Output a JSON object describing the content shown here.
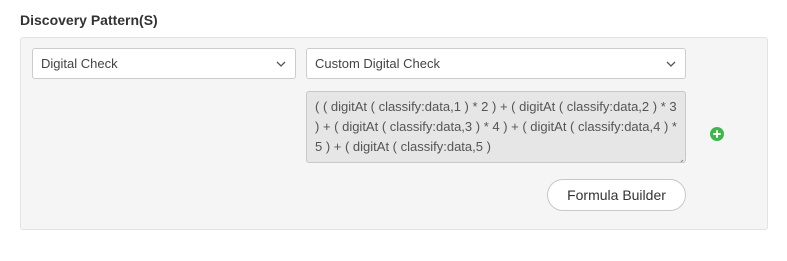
{
  "section": {
    "title": "Discovery Pattern(S)"
  },
  "pattern": {
    "type_select": {
      "selected": "Digital Check",
      "icon": "chevron-down-icon"
    },
    "subtype_select": {
      "selected": "Custom Digital Check",
      "icon": "chevron-down-icon"
    },
    "formula_text": "( ( digitAt ( classify:data,1 ) * 2 ) + ( digitAt ( classify:data,2 ) * 3 ) + ( digitAt ( classify:data,3 ) * 4 ) + ( digitAt ( classify:data,4 ) * 5 ) + ( digitAt ( classify:data,5 )",
    "add_icon": "plus-circle-icon",
    "formula_builder_label": "Formula Builder"
  },
  "colors": {
    "add_icon_green": "#3cb84a",
    "panel_background": "#f5f5f5",
    "formula_background": "#e6e6e6"
  }
}
